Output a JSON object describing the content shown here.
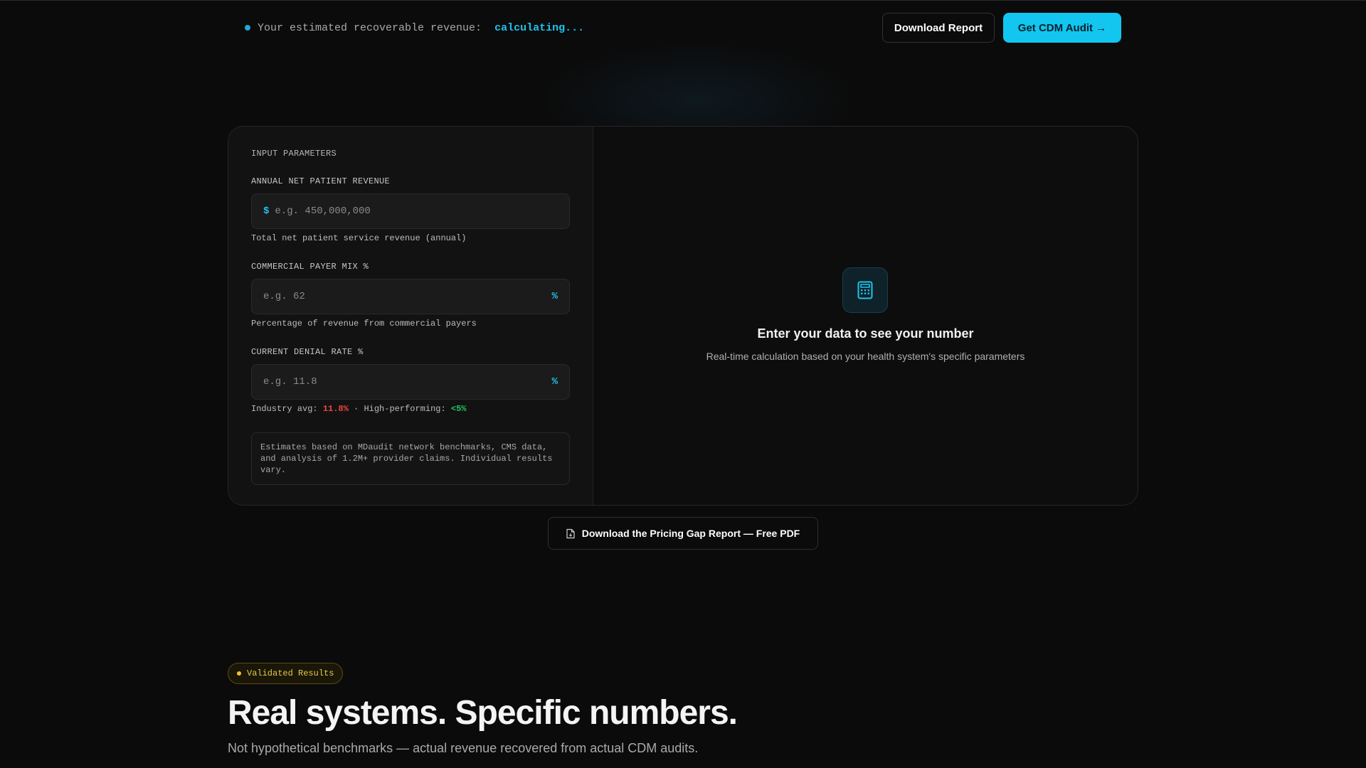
{
  "topbar": {
    "revenue_label": "Your estimated recoverable revenue:",
    "revenue_value": "calculating...",
    "download_report": "Download Report",
    "get_audit": "Get CDM Audit →"
  },
  "calculator": {
    "section_title": "INPUT PARAMETERS",
    "fields": [
      {
        "label": "ANNUAL NET PATIENT REVENUE",
        "prefix": "$",
        "placeholder": "e.g. 450,000,000",
        "help": "Total net patient service revenue (annual)"
      },
      {
        "label": "COMMERCIAL PAYER MIX %",
        "suffix": "%",
        "placeholder": "e.g. 62",
        "help": "Percentage of revenue from commercial payers"
      },
      {
        "label": "CURRENT DENIAL RATE %",
        "suffix": "%",
        "placeholder": "e.g. 11.8",
        "help_prefix": "Industry avg:",
        "help_avg": "11.8%",
        "help_sep": "· High-performing:",
        "help_high": "<5%"
      }
    ],
    "note": "Estimates based on MDaudit network benchmarks, CMS data, and analysis of 1.2M+ provider claims. Individual results vary.",
    "empty_state": {
      "icon": "calculator-icon",
      "title": "Enter your data to see your number",
      "subtitle": "Real-time calculation based on your health system's specific parameters"
    }
  },
  "pdf_button": "Download the Pricing Gap Report — Free PDF",
  "results": {
    "badge": "Validated Results",
    "headline": "Real systems. Specific numbers.",
    "subheadline": "Not hypothetical benchmarks — actual revenue recovered from actual CDM audits."
  },
  "colors": {
    "accent": "#12c6f0",
    "bad": "#ef4444",
    "good": "#22c55e",
    "badge": "#e9c84b"
  }
}
